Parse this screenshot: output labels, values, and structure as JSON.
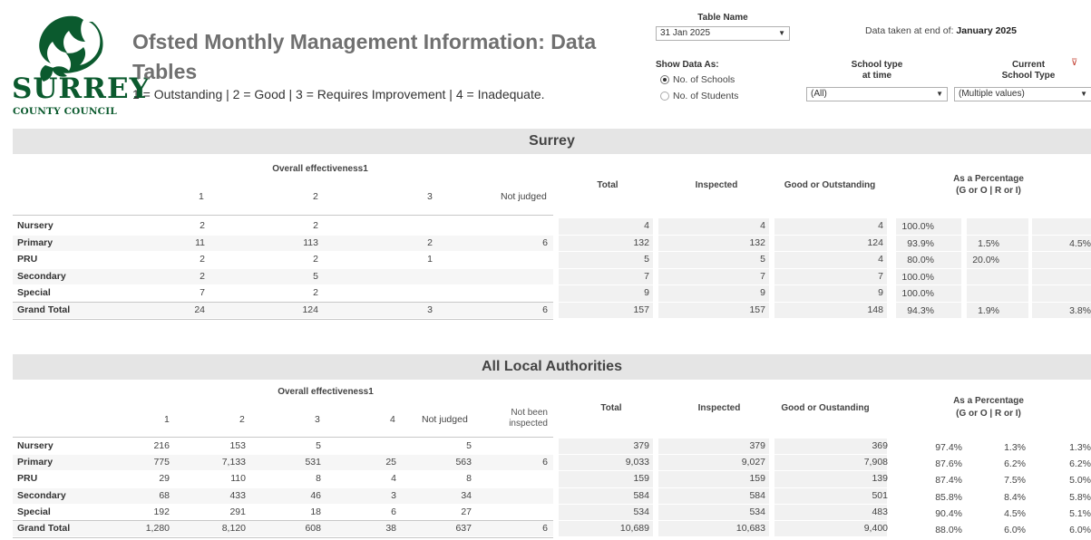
{
  "header": {
    "logo_word": "SURREY",
    "logo_sub": "COUNTY COUNCIL",
    "title": "Ofsted Monthly Management Information: Data Tables",
    "legend": "1 = Outstanding | 2 = Good | 3 = Requires Improvement | 4 = Inadequate."
  },
  "controls": {
    "table_name_label": "Table Name",
    "table_name_value": "31 Jan 2025",
    "data_taken_prefix": "Data taken at end of:",
    "data_taken_value": "January 2025",
    "show_data_label": "Show Data As:",
    "radio_schools": "No. of Schools",
    "radio_students": "No. of Students",
    "school_type_label_1": "School type",
    "school_type_label_2": "at time",
    "school_type_value": "(All)",
    "current_type_label_1": "Current",
    "current_type_label_2": "School Type",
    "current_type_value": "(Multiple values)"
  },
  "surrey": {
    "band": "Surrey",
    "group_header": "Overall effectiveness1",
    "col_1": "1",
    "col_2": "2",
    "col_3": "3",
    "col_nj": "Not judged",
    "col_total": "Total",
    "col_inspected": "Inspected",
    "col_good": "Good or Outstanding",
    "pct_line1": "As a Percentage",
    "pct_line2": "(G or O | R or I)",
    "rows": [
      {
        "label": "Nursery",
        "c1": "2",
        "c2": "2",
        "c3": "",
        "nj": "",
        "total": "4",
        "inspected": "4",
        "good": "4",
        "p1": "100.0%",
        "p2": "",
        "p3": ""
      },
      {
        "label": "Primary",
        "c1": "11",
        "c2": "113",
        "c3": "2",
        "nj": "6",
        "total": "132",
        "inspected": "132",
        "good": "124",
        "p1": "93.9%",
        "p2": "1.5%",
        "p3": "4.5%"
      },
      {
        "label": "PRU",
        "c1": "2",
        "c2": "2",
        "c3": "1",
        "nj": "",
        "total": "5",
        "inspected": "5",
        "good": "4",
        "p1": "80.0%",
        "p2": "20.0%",
        "p3": ""
      },
      {
        "label": "Secondary",
        "c1": "2",
        "c2": "5",
        "c3": "",
        "nj": "",
        "total": "7",
        "inspected": "7",
        "good": "7",
        "p1": "100.0%",
        "p2": "",
        "p3": ""
      },
      {
        "label": "Special",
        "c1": "7",
        "c2": "2",
        "c3": "",
        "nj": "",
        "total": "9",
        "inspected": "9",
        "good": "9",
        "p1": "100.0%",
        "p2": "",
        "p3": ""
      },
      {
        "label": "Grand Total",
        "c1": "24",
        "c2": "124",
        "c3": "3",
        "nj": "6",
        "total": "157",
        "inspected": "157",
        "good": "148",
        "p1": "94.3%",
        "p2": "1.9%",
        "p3": "3.8%"
      }
    ]
  },
  "all_la": {
    "band": "All Local Authorities",
    "group_header": "Overall effectiveness1",
    "col_1": "1",
    "col_2": "2",
    "col_3": "3",
    "col_4": "4",
    "col_nj": "Not judged",
    "col_nbi_1": "Not been",
    "col_nbi_2": "inspected",
    "col_total": "Total",
    "col_inspected": "Inspected",
    "col_good": "Good or Oustanding",
    "pct_line1": "As a Percentage",
    "pct_line2": "(G or O | R or I)",
    "rows": [
      {
        "label": "Nursery",
        "c1": "216",
        "c2": "153",
        "c3": "5",
        "c4": "",
        "nj": "5",
        "nbi": "",
        "total": "379",
        "inspected": "379",
        "good": "369",
        "p1": "97.4%",
        "p2": "1.3%",
        "p3": "1.3%"
      },
      {
        "label": "Primary",
        "c1": "775",
        "c2": "7,133",
        "c3": "531",
        "c4": "25",
        "nj": "563",
        "nbi": "6",
        "total": "9,033",
        "inspected": "9,027",
        "good": "7,908",
        "p1": "87.6%",
        "p2": "6.2%",
        "p3": "6.2%"
      },
      {
        "label": "PRU",
        "c1": "29",
        "c2": "110",
        "c3": "8",
        "c4": "4",
        "nj": "8",
        "nbi": "",
        "total": "159",
        "inspected": "159",
        "good": "139",
        "p1": "87.4%",
        "p2": "7.5%",
        "p3": "5.0%"
      },
      {
        "label": "Secondary",
        "c1": "68",
        "c2": "433",
        "c3": "46",
        "c4": "3",
        "nj": "34",
        "nbi": "",
        "total": "584",
        "inspected": "584",
        "good": "501",
        "p1": "85.8%",
        "p2": "8.4%",
        "p3": "5.8%"
      },
      {
        "label": "Special",
        "c1": "192",
        "c2": "291",
        "c3": "18",
        "c4": "6",
        "nj": "27",
        "nbi": "",
        "total": "534",
        "inspected": "534",
        "good": "483",
        "p1": "90.4%",
        "p2": "4.5%",
        "p3": "5.1%"
      },
      {
        "label": "Grand Total",
        "c1": "1,280",
        "c2": "8,120",
        "c3": "608",
        "c4": "38",
        "nj": "637",
        "nbi": "6",
        "total": "10,689",
        "inspected": "10,683",
        "good": "9,400",
        "p1": "88.0%",
        "p2": "6.0%",
        "p3": "6.0%"
      }
    ]
  }
}
